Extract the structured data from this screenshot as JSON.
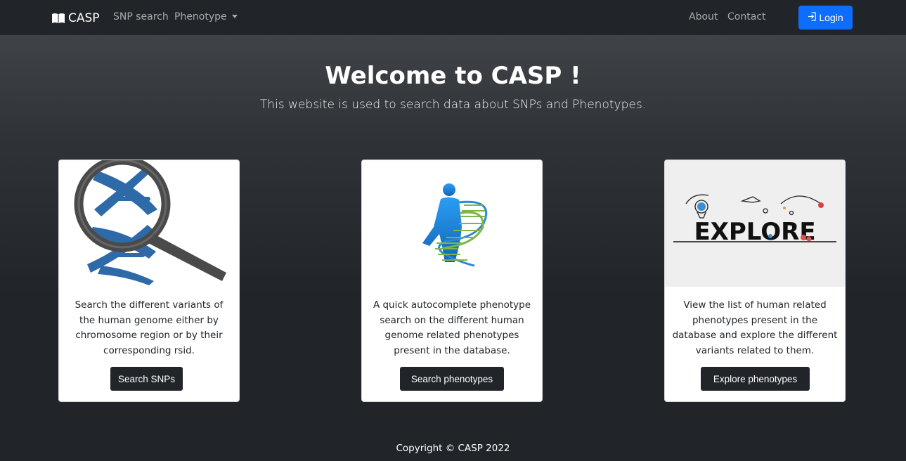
{
  "nav": {
    "brand": "CASP",
    "links": [
      {
        "label": "SNP search"
      },
      {
        "label": "Phenotype"
      }
    ],
    "right_links": [
      {
        "label": "About"
      },
      {
        "label": "Contact"
      }
    ],
    "login_label": "Login",
    "accent_color": "#0d6efd"
  },
  "hero": {
    "title": "Welcome to CASP !",
    "subtitle": "This website is used to search data about SNPs and Phenotypes."
  },
  "cards": [
    {
      "image": "dna-magnifier-image",
      "text": "Search the different variants of the human genome either by chromosome region or by their corresponding rsid.",
      "button": "Search SNPs"
    },
    {
      "image": "human-dna-image",
      "text": "A quick autocomplete phenotype search on the different human genome related phenotypes present in the database.",
      "button": "Search phenotypes"
    },
    {
      "image": "explore-illustration-image",
      "image_text": "EXPLORE",
      "text": "View the list of human related phenotypes present in the database and explore the different variants related to them.",
      "button": "Explore phenotypes"
    }
  ],
  "footer": {
    "copyright": "Copyright © CASP 2022"
  }
}
